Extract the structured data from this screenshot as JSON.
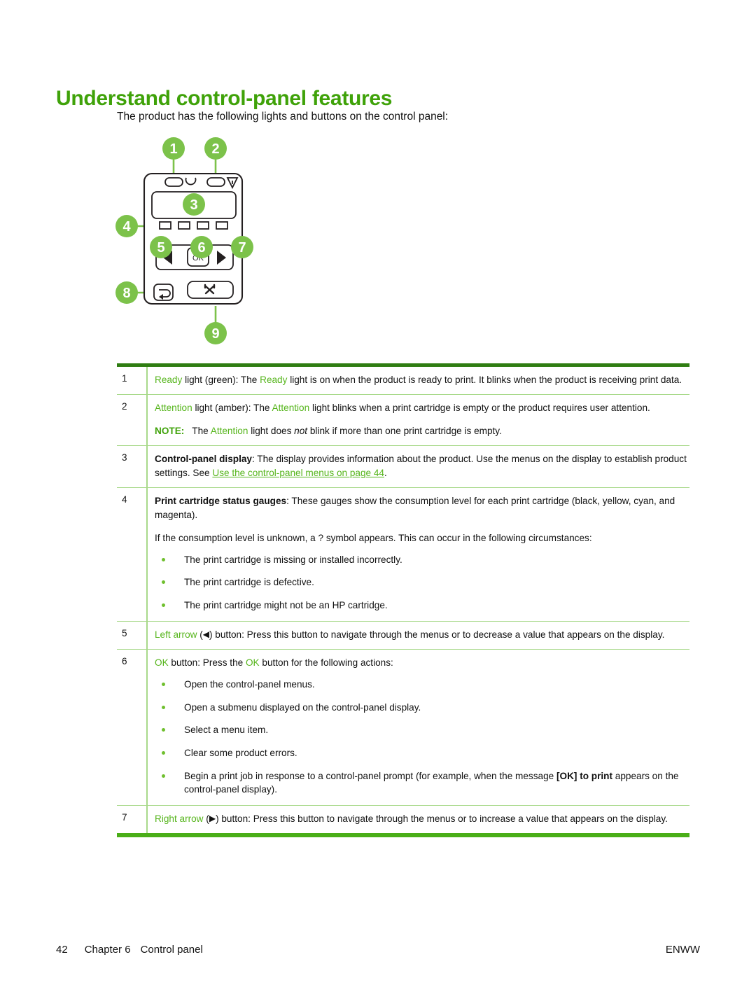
{
  "page": {
    "title": "Understand control-panel features",
    "intro": "The product has the following lights and buttons on the control panel:",
    "title_color": "#3fa209",
    "accent_green": "#56b51c",
    "callout_green": "#7cc24a"
  },
  "diagram": {
    "name": "control-panel-diagram",
    "callouts": [
      "1",
      "2",
      "3",
      "4",
      "5",
      "6",
      "7",
      "8",
      "9"
    ],
    "ok_label": "OK",
    "elements": [
      "ready-light",
      "attention-light",
      "control-panel-display",
      "cartridge-status-gauges",
      "left-arrow-button",
      "ok-button",
      "right-arrow-button",
      "back-button",
      "cancel-button"
    ]
  },
  "table": {
    "rows": [
      {
        "num": "1",
        "segments": [
          {
            "t": "Ready",
            "s": "green"
          },
          {
            "t": " light (green): The ",
            "s": "plain"
          },
          {
            "t": "Ready",
            "s": "green"
          },
          {
            "t": " light is on when the product is ready to print. It blinks when the product is receiving print data.",
            "s": "plain"
          }
        ]
      },
      {
        "num": "2",
        "segments": [
          {
            "t": "Attention",
            "s": "green"
          },
          {
            "t": " light (amber): The ",
            "s": "plain"
          },
          {
            "t": "Attention",
            "s": "green"
          },
          {
            "t": " light blinks when a print cartridge is empty or the product requires user attention.",
            "s": "plain"
          }
        ],
        "note": {
          "label": "NOTE:",
          "segments": [
            {
              "t": "The ",
              "s": "plain"
            },
            {
              "t": "Attention",
              "s": "green"
            },
            {
              "t": " light does ",
              "s": "plain"
            },
            {
              "t": "not",
              "s": "italic"
            },
            {
              "t": " blink if more than one print cartridge is empty.",
              "s": "plain"
            }
          ]
        }
      },
      {
        "num": "3",
        "segments": [
          {
            "t": "Control-panel display",
            "s": "bold"
          },
          {
            "t": ": The display provides information about the product. Use the menus on the display to establish product settings. See ",
            "s": "plain"
          },
          {
            "t": "Use the control-panel menus on page 44",
            "s": "link"
          },
          {
            "t": ".",
            "s": "plain"
          }
        ]
      },
      {
        "num": "4",
        "segments": [
          {
            "t": "Print cartridge status gauges",
            "s": "bold"
          },
          {
            "t": ": These gauges show the consumption level for each print cartridge (black, yellow, cyan, and magenta).",
            "s": "plain"
          }
        ],
        "paragraph2": "If the consumption level is unknown, a ? symbol appears. This can occur in the following circumstances:",
        "bullets": [
          "The print cartridge is missing or installed incorrectly.",
          "The print cartridge is defective.",
          "The print cartridge might not be an HP cartridge."
        ]
      },
      {
        "num": "5",
        "segments": [
          {
            "t": "Left arrow",
            "s": "green"
          },
          {
            "t": " (",
            "s": "plain"
          },
          {
            "t": "◀",
            "s": "arrow"
          },
          {
            "t": ") button: Press this button to navigate through the menus or to decrease a value that appears on the display.",
            "s": "plain"
          }
        ]
      },
      {
        "num": "6",
        "segments": [
          {
            "t": "OK",
            "s": "green"
          },
          {
            "t": " button: Press the ",
            "s": "plain"
          },
          {
            "t": "OK",
            "s": "green"
          },
          {
            "t": " button for the following actions:",
            "s": "plain"
          }
        ],
        "bullets": [
          "Open the control-panel menus.",
          "Open a submenu displayed on the control-panel display.",
          "Select a menu item.",
          "Clear some product errors."
        ],
        "last_bullet_segments": [
          {
            "t": "Begin a print job in response to a control-panel prompt (for example, when the message ",
            "s": "plain"
          },
          {
            "t": "[OK] to print",
            "s": "bold"
          },
          {
            "t": " appears on the control-panel display).",
            "s": "plain"
          }
        ]
      },
      {
        "num": "7",
        "segments": [
          {
            "t": "Right arrow",
            "s": "green"
          },
          {
            "t": " (",
            "s": "plain"
          },
          {
            "t": "▶",
            "s": "arrow"
          },
          {
            "t": ") button: Press this button to navigate through the menus or to increase a value that appears on the display.",
            "s": "plain"
          }
        ]
      }
    ]
  },
  "footer": {
    "page_number": "42",
    "chapter": "Chapter 6",
    "section": "Control panel",
    "locale": "ENWW"
  }
}
